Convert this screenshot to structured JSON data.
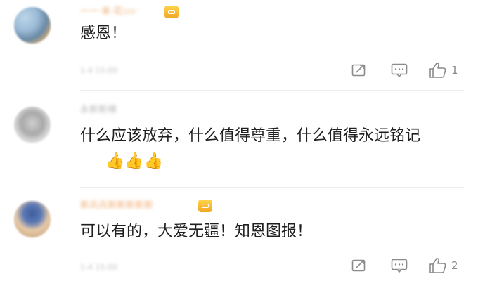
{
  "comments": [
    {
      "name": "一一·来·花▫▫·",
      "text": "感恩！",
      "meta": "1-4 15:00",
      "like_count": "1",
      "vip": true
    },
    {
      "name": "永新新梯",
      "text": "什么应该放弃，什么值得尊重，什么值得永远铭记",
      "thumbs": "👍👍👍",
      "meta": "1-4 15:00",
      "like_count": "",
      "vip": false
    },
    {
      "name": "新兵兵新新新新新",
      "text": "可以有的，大爱无疆！知恩图报！",
      "meta": "1-4 15:00",
      "like_count": "2",
      "vip": true
    }
  ],
  "colors": {
    "text": "#1f1f1f",
    "icon": "#8a8a8a",
    "vip_gold": "#f2a623",
    "name_blur": "#f0b07a"
  },
  "icons": [
    "share-icon",
    "comment-icon",
    "like-icon",
    "vip-badge-icon",
    "thumbs-up-emoji"
  ]
}
